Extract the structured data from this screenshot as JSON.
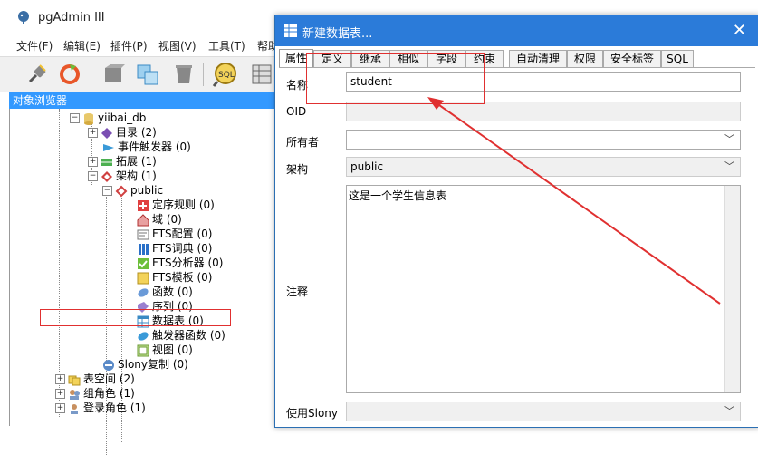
{
  "main": {
    "title": "pgAdmin III",
    "menu": [
      "文件(F)",
      "编辑(E)",
      "插件(P)",
      "视图(V)",
      "工具(T)",
      "帮助"
    ],
    "browser_header": "对象浏览器",
    "tree": [
      {
        "label": "yiibai_db",
        "icon": "database-icon"
      },
      {
        "label": "目录 (2)",
        "icon": "catalog-icon"
      },
      {
        "label": "事件触发器 (0)",
        "icon": "event-trigger-icon"
      },
      {
        "label": "拓展 (1)",
        "icon": "extension-icon"
      },
      {
        "label": "架构 (1)",
        "icon": "schema-icon"
      },
      {
        "label": "public",
        "icon": "schema-public-icon"
      },
      {
        "label": "定序规则 (0)",
        "icon": "collation-icon"
      },
      {
        "label": "域 (0)",
        "icon": "domain-icon"
      },
      {
        "label": "FTS配置 (0)",
        "icon": "fts-config-icon"
      },
      {
        "label": "FTS词典 (0)",
        "icon": "fts-dictionary-icon"
      },
      {
        "label": "FTS分析器 (0)",
        "icon": "fts-parser-icon"
      },
      {
        "label": "FTS模板 (0)",
        "icon": "fts-template-icon"
      },
      {
        "label": "函数 (0)",
        "icon": "function-icon"
      },
      {
        "label": "序列 (0)",
        "icon": "sequence-icon"
      },
      {
        "label": "数据表 (0)",
        "icon": "table-icon"
      },
      {
        "label": "触发器函数 (0)",
        "icon": "trigger-function-icon"
      },
      {
        "label": "视图 (0)",
        "icon": "view-icon"
      },
      {
        "label": "Slony复制 (0)",
        "icon": "slony-icon"
      },
      {
        "label": "表空间 (2)",
        "icon": "tablespace-icon"
      },
      {
        "label": "组角色 (1)",
        "icon": "group-role-icon"
      },
      {
        "label": "登录角色 (1)",
        "icon": "login-role-icon"
      }
    ]
  },
  "dialog": {
    "title": "新建数据表...",
    "tabs": [
      "属性",
      "定义",
      "继承",
      "相似",
      "字段",
      "约束",
      "自动清理",
      "权限",
      "安全标签",
      "SQL"
    ],
    "labels": {
      "name": "名称",
      "oid": "OID",
      "owner": "所有者",
      "schema": "架构",
      "comment": "注释",
      "slony": "使用Slony"
    },
    "values": {
      "name": "student",
      "oid": "",
      "owner": "",
      "schema": "public",
      "comment": "这是一个学生信息表",
      "slony": ""
    }
  },
  "colors": {
    "accent": "#2b7bd9",
    "highlight": "#e03030",
    "browser_header": "#3399ff"
  }
}
